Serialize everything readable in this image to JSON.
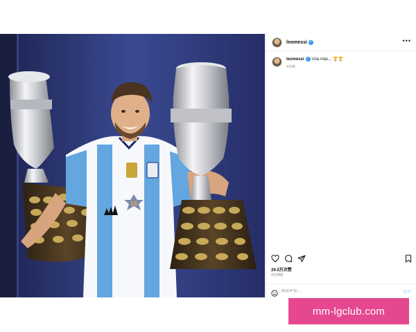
{
  "post": {
    "username": "leomessi",
    "more_icon": "more-horizontal-icon",
    "caption": {
      "username": "leomessi",
      "text": "Una más... ",
      "emoji": "🏆🏆",
      "time": "4分钟"
    },
    "actions": {
      "like_icon": "heart-icon",
      "comment_icon": "comment-icon",
      "share_icon": "send-icon",
      "save_icon": "bookmark-icon"
    },
    "likes": "29.5万次赞",
    "time": "4分钟前",
    "comment_placeholder": "添加评论...",
    "post_button": "发布"
  },
  "photo": {
    "jersey_number": "16"
  },
  "watermark": "mm-lgclub.com",
  "colors": {
    "verified": "#3797f0",
    "watermark_bg": "#e5488f",
    "backdrop": "#2e3a78"
  }
}
